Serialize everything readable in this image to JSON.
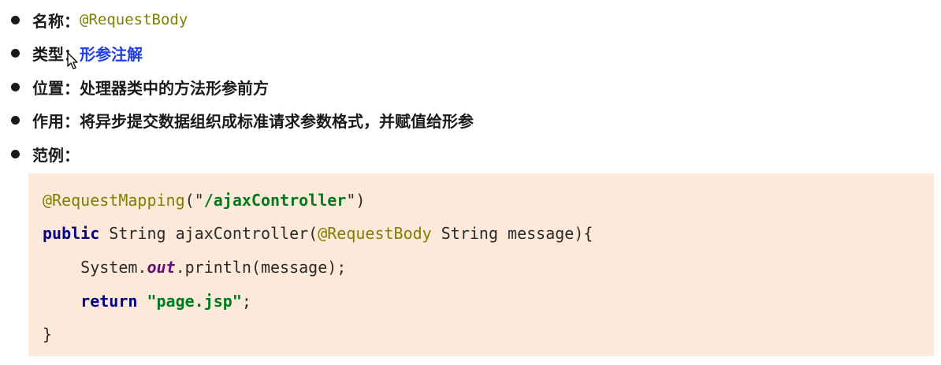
{
  "items": [
    {
      "label": "名称：",
      "value": "@RequestBody"
    },
    {
      "label": "类型：",
      "value": "形参注解"
    },
    {
      "label": "位置：",
      "value": "处理器类中的方法形参前方"
    },
    {
      "label": "作用：",
      "value": "将异步提交数据组织成标准请求参数格式，并赋值给形参"
    },
    {
      "label": "范例：",
      "value": ""
    }
  ],
  "code": {
    "line1": {
      "annotation": "@RequestMapping",
      "open": "(\"",
      "string": "/ajaxController",
      "close": "\")"
    },
    "line2": {
      "keyword": "public",
      "text1": " String ajaxController(",
      "annotation": "@RequestBody",
      "text2": " String message){"
    },
    "line3": {
      "indent": "    ",
      "text1": "System.",
      "field": "out",
      "text2": ".println(message);"
    },
    "line4": {
      "indent": "    ",
      "keyword": "return",
      "space": " ",
      "quote_open": "\"",
      "string": "page.jsp",
      "quote_close": "\"",
      "end": ";"
    },
    "line5": {
      "text": "}"
    }
  },
  "colors": {
    "annotation": "#808000",
    "keyword": "#000080",
    "string": "#007a1f",
    "field": "#660e7a",
    "link": "#1f3fe8",
    "code_bg": "#fde9d9"
  },
  "icons": [
    "mouse-cursor-icon"
  ]
}
